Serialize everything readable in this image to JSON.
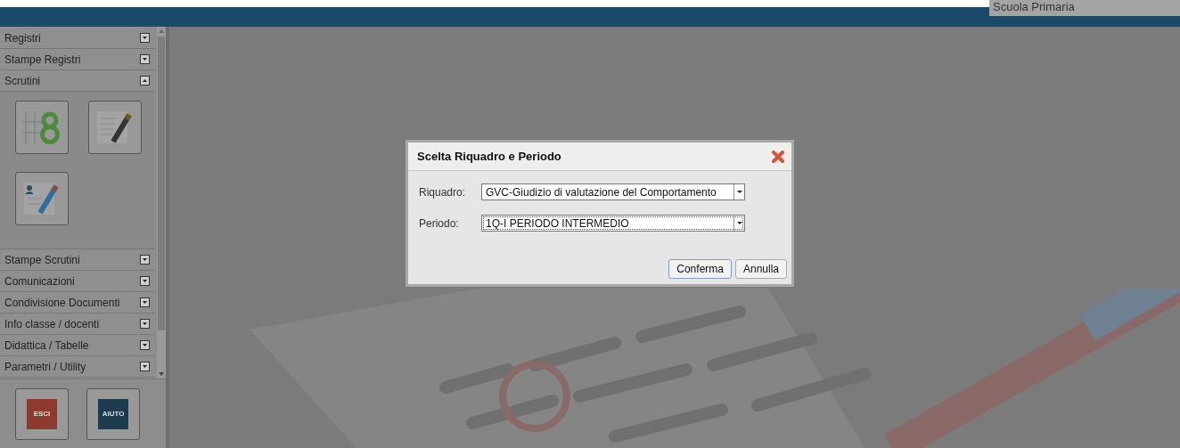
{
  "header": {
    "school_label": "Scuola Primaria"
  },
  "sidebar": {
    "sections": [
      {
        "label": "Registri",
        "expanded": false
      },
      {
        "label": "Stampe Registri",
        "expanded": false
      },
      {
        "label": "Scrutini",
        "expanded": true,
        "tools": [
          {
            "kind": "grades"
          },
          {
            "kind": "edit"
          },
          {
            "kind": "student-edit"
          }
        ]
      },
      {
        "label": "Stampe Scrutini",
        "expanded": false
      },
      {
        "label": "Comunicazioni",
        "expanded": false
      },
      {
        "label": "Condivisione Documenti",
        "expanded": false
      },
      {
        "label": "Info classe / docenti",
        "expanded": false
      },
      {
        "label": "Didattica / Tabelle",
        "expanded": false
      },
      {
        "label": "Parametri / Utility",
        "expanded": false
      }
    ],
    "footer_buttons": [
      {
        "label": "ESCI",
        "kind": "exit"
      },
      {
        "label": "AIUTO",
        "kind": "help"
      }
    ]
  },
  "dialog": {
    "title": "Scelta Riquadro e Periodo",
    "fields": [
      {
        "label": "Riquadro:",
        "value": "GVC-Giudizio di valutazione del Comportamento",
        "focused": false
      },
      {
        "label": "Periodo:",
        "value": "1Q-I PERIODO INTERMEDIO",
        "focused": true
      }
    ],
    "buttons": [
      {
        "label": "Conferma",
        "focused": true
      },
      {
        "label": "Annulla",
        "focused": false
      }
    ]
  }
}
